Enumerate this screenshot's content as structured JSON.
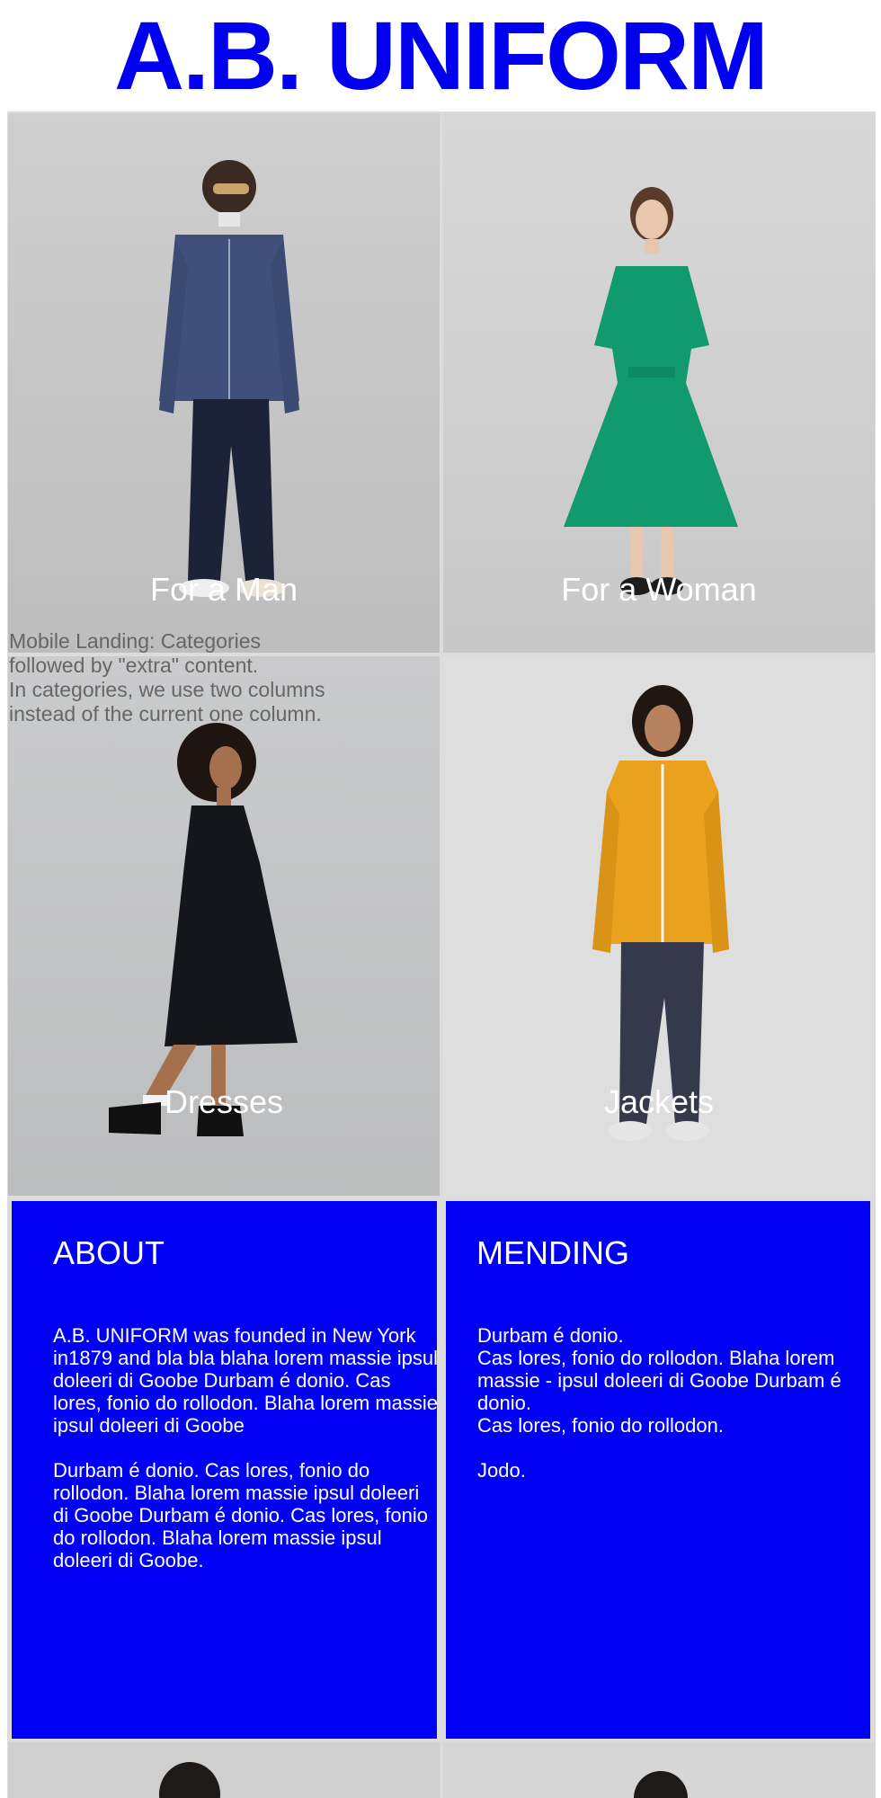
{
  "brand": {
    "title": "A.B. UNIFORM",
    "color": "#0000ee"
  },
  "categories": [
    {
      "label": "For a Man",
      "image": "man-in-denim-jacket"
    },
    {
      "label": "For a Woman",
      "image": "woman-in-green-dress"
    },
    {
      "label": "Dresses",
      "image": "woman-in-black-dress"
    },
    {
      "label": "Jackets",
      "image": "man-in-yellow-jacket"
    }
  ],
  "note": {
    "lines": [
      "Mobile Landing: Categories",
      "followed by \"extra\" content.",
      "In categories, we use two columns",
      "instead of the current one column."
    ]
  },
  "about": {
    "title": "ABOUT",
    "paragraphs": [
      "A.B. UNIFORM was founded in New York in1879 and bla bla blaha lorem massie ipsul doleeri di Goobe Durbam é donio. Cas lores, fonio do rollodon. Blaha lorem massie ipsul doleeri di Goobe",
      "Durbam é donio. Cas lores, fonio do rollodon. Blaha lorem massie ipsul doleeri di Goobe Durbam é donio. Cas lores, fonio do rollodon. Blaha lorem massie ipsul doleeri di Goobe."
    ]
  },
  "mending": {
    "title": "MENDING",
    "lines": [
      "Durbam é donio.",
      "Cas lores, fonio do rollodon. Blaha lorem massie - ipsul doleeri di Goobe Durbam é donio.",
      "Cas lores, fonio do rollodon."
    ],
    "footer": "Jodo."
  },
  "colors": {
    "panel_blue": "#0000f5",
    "note_gray": "#666666"
  }
}
